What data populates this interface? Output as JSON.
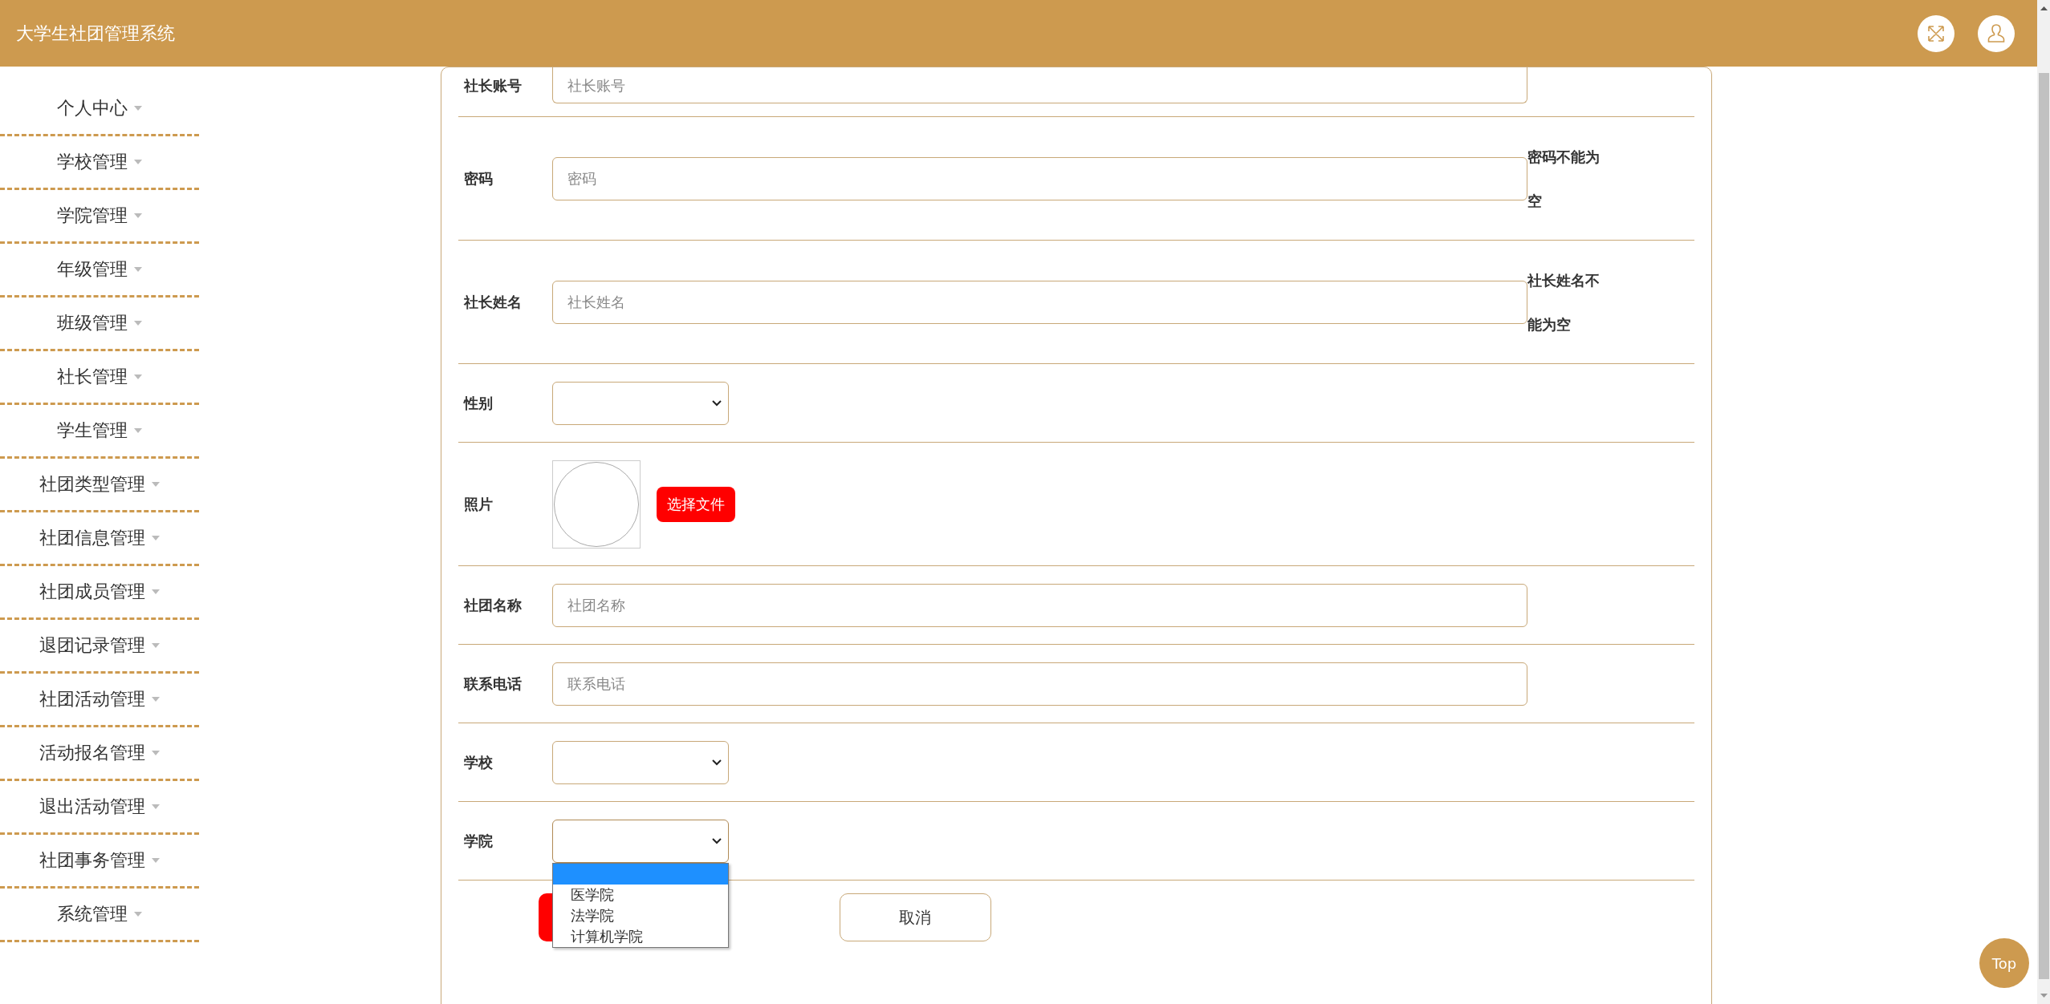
{
  "header": {
    "title": "大学生社团管理系统"
  },
  "sidebar": {
    "items": [
      {
        "label": "个人中心"
      },
      {
        "label": "学校管理"
      },
      {
        "label": "学院管理"
      },
      {
        "label": "年级管理"
      },
      {
        "label": "班级管理"
      },
      {
        "label": "社长管理"
      },
      {
        "label": "学生管理"
      },
      {
        "label": "社团类型管理"
      },
      {
        "label": "社团信息管理"
      },
      {
        "label": "社团成员管理"
      },
      {
        "label": "退团记录管理"
      },
      {
        "label": "社团活动管理"
      },
      {
        "label": "活动报名管理"
      },
      {
        "label": "退出活动管理"
      },
      {
        "label": "社团事务管理"
      },
      {
        "label": "系统管理"
      }
    ]
  },
  "form": {
    "rows": [
      {
        "kind": "text",
        "label": "社长账号",
        "placeholder": "社长账号"
      },
      {
        "kind": "text",
        "label": "密码",
        "placeholder": "密码",
        "error": "密码不能为空"
      },
      {
        "kind": "text",
        "label": "社长姓名",
        "placeholder": "社长姓名",
        "error": "社长姓名不能为空"
      },
      {
        "kind": "select",
        "label": "性别",
        "open": false
      },
      {
        "kind": "photo",
        "label": "照片",
        "button": "选择文件"
      },
      {
        "kind": "text",
        "label": "社团名称",
        "placeholder": "社团名称"
      },
      {
        "kind": "text",
        "label": "联系电话",
        "placeholder": "联系电话"
      },
      {
        "kind": "select",
        "label": "学校",
        "open": false
      },
      {
        "kind": "select",
        "label": "学院",
        "open": true,
        "blank_option_highlighted": true,
        "options": [
          {
            "label": "医学院"
          },
          {
            "label": "法学院"
          },
          {
            "label": "计算机学院"
          }
        ]
      }
    ],
    "buttons": [
      {
        "kind": "primary"
      },
      {
        "kind": "secondary",
        "label": "取消"
      }
    ]
  },
  "top_button": {
    "label": "Top"
  }
}
